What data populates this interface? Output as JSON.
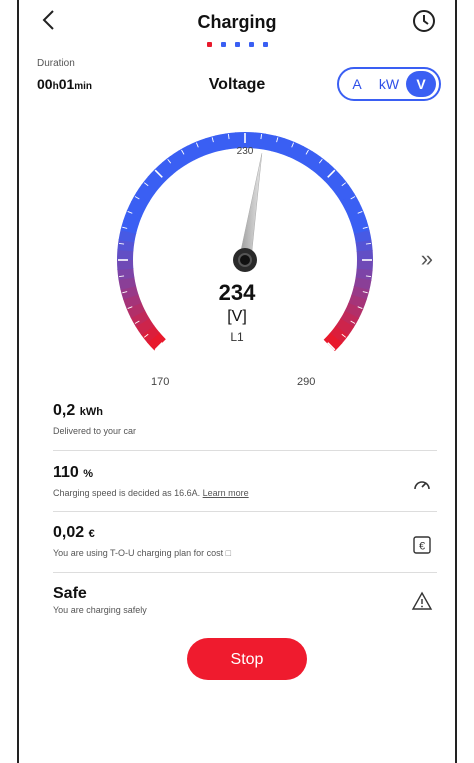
{
  "header": {
    "title": "Charging",
    "back_icon": "chevron-left-icon",
    "history_icon": "clock-icon",
    "pager": {
      "total": 5,
      "active_index": 0,
      "active_color": "#e8192c",
      "inactive_color": "#3a5ff3"
    }
  },
  "duration": {
    "label": "Duration",
    "hours": "00",
    "h": "h",
    "minutes": "01",
    "min": "min"
  },
  "mode_title": "Voltage",
  "units": {
    "options": [
      "A",
      "kW",
      "V"
    ],
    "active": "V"
  },
  "gauge": {
    "value": "234",
    "unit": "[V]",
    "phase": "L1",
    "min_label": "170",
    "max_label": "290",
    "mid_label": "230",
    "min": 170,
    "max": 290,
    "reading": 234,
    "colors": {
      "start": "#e8192c",
      "end": "#3a5ff3"
    }
  },
  "next_icon": "double-chevron-right-icon",
  "stats": [
    {
      "value": "0,2",
      "unit": "kWh",
      "desc": "Delivered to your car",
      "icon": ""
    },
    {
      "value": "110",
      "unit": "%",
      "desc": "Charging speed is decided as 16.6A.",
      "link": "Learn more",
      "icon": "speedometer-icon"
    },
    {
      "value": "0,02",
      "unit": "€",
      "desc": "You are using T-O-U charging plan for cost",
      "icon": "euro-icon"
    },
    {
      "value": "Safe",
      "unit": "",
      "desc": "You are charging safely",
      "icon": "warning-icon"
    }
  ],
  "stop_label": "Stop",
  "colors": {
    "accent": "#3a5ff3",
    "danger": "#ef1b2e"
  }
}
